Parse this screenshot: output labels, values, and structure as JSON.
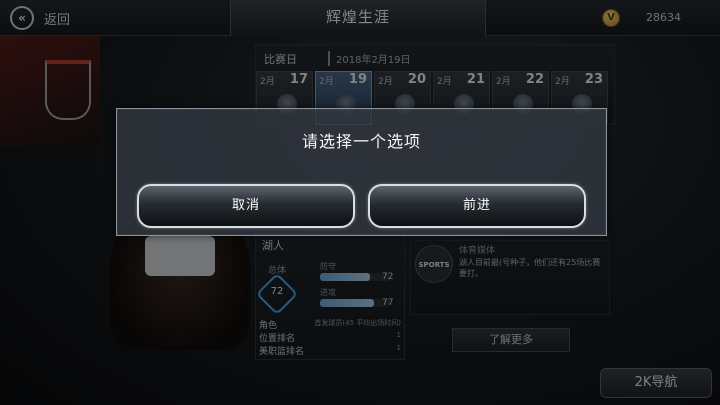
{
  "header": {
    "back_label": "返回",
    "title": "辉煌生涯",
    "currency": "28634",
    "icons": {
      "back": "double-chevron-left-icon",
      "coin": "vc-coin-icon"
    }
  },
  "schedule": {
    "match_day_label": "比赛日",
    "date": "2018年2月19日",
    "days": [
      {
        "month": "2月",
        "day": "17"
      },
      {
        "month": "2月",
        "day": "19"
      },
      {
        "month": "2月",
        "day": "20"
      },
      {
        "month": "2月",
        "day": "21"
      },
      {
        "month": "2月",
        "day": "22"
      },
      {
        "month": "2月",
        "day": "23"
      }
    ]
  },
  "team": {
    "name": "湖人",
    "overall_label": "总体",
    "overall": "72",
    "attributes": [
      {
        "label": "防守",
        "value": "72",
        "fill": 0.72
      },
      {
        "label": "进攻",
        "value": "77",
        "fill": 0.77
      }
    ],
    "rows": [
      {
        "label": "角色",
        "value": "首发球员(45 平均出场时间)"
      },
      {
        "label": "位置排名",
        "value": "1"
      },
      {
        "label": "美职篮排名",
        "value": "1"
      }
    ]
  },
  "news": {
    "badge": "SPORTS",
    "title": "体育媒体",
    "body": "湖人目前最(号种子，他们还有25场比赛要打。"
  },
  "learn_more_label": "了解更多",
  "nav_label": "2K导航",
  "dialog": {
    "title": "请选择一个选项",
    "cancel_label": "取消",
    "proceed_label": "前进"
  }
}
